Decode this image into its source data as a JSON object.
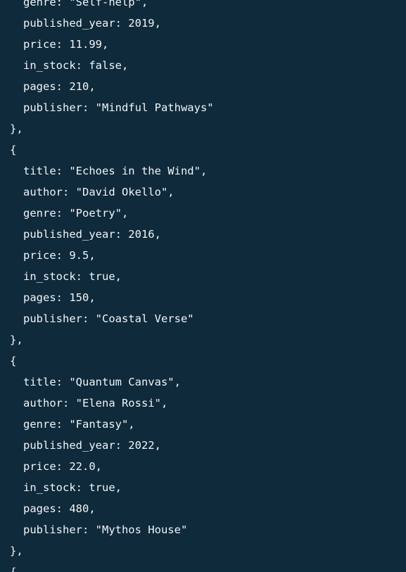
{
  "code": {
    "lines": [
      {
        "text": "genre: \"Self-help\",",
        "indent": true
      },
      {
        "text": "published_year: 2019,",
        "indent": true
      },
      {
        "text": "price: 11.99,",
        "indent": true
      },
      {
        "text": "in_stock: false,",
        "indent": true
      },
      {
        "text": "pages: 210,",
        "indent": true
      },
      {
        "text": "publisher: \"Mindful Pathways\"",
        "indent": true
      },
      {
        "text": "},",
        "indent": false
      },
      {
        "text": "{",
        "indent": false
      },
      {
        "text": "title: \"Echoes in the Wind\",",
        "indent": true
      },
      {
        "text": "author: \"David Okello\",",
        "indent": true
      },
      {
        "text": "genre: \"Poetry\",",
        "indent": true
      },
      {
        "text": "published_year: 2016,",
        "indent": true
      },
      {
        "text": "price: 9.5,",
        "indent": true
      },
      {
        "text": "in_stock: true,",
        "indent": true
      },
      {
        "text": "pages: 150,",
        "indent": true
      },
      {
        "text": "publisher: \"Coastal Verse\"",
        "indent": true
      },
      {
        "text": "},",
        "indent": false
      },
      {
        "text": "{",
        "indent": false
      },
      {
        "text": "title: \"Quantum Canvas\",",
        "indent": true
      },
      {
        "text": "author: \"Elena Rossi\",",
        "indent": true
      },
      {
        "text": "genre: \"Fantasy\",",
        "indent": true
      },
      {
        "text": "published_year: 2022,",
        "indent": true
      },
      {
        "text": "price: 22.0,",
        "indent": true
      },
      {
        "text": "in_stock: true,",
        "indent": true
      },
      {
        "text": "pages: 480,",
        "indent": true
      },
      {
        "text": "publisher: \"Mythos House\"",
        "indent": true
      },
      {
        "text": "},",
        "indent": false
      },
      {
        "text": "{",
        "indent": false
      }
    ]
  },
  "colors": {
    "background": "#0f2a3a",
    "text": "#f1f5f9"
  }
}
